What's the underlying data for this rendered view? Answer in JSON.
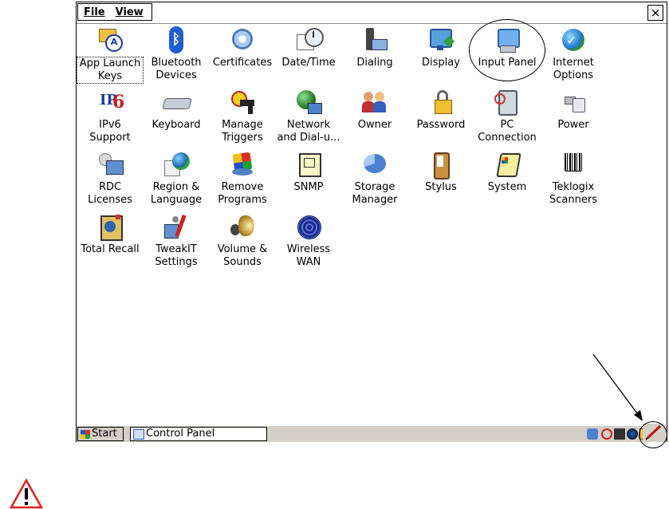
{
  "menu": {
    "file_label": "File",
    "view_label": "View",
    "close_label": "×"
  },
  "items": [
    {
      "label": "App Launch Keys",
      "icon": "app-launch-keys-icon",
      "selected": true
    },
    {
      "label": "Bluetooth Devices",
      "icon": "bluetooth-icon"
    },
    {
      "label": "Certificates",
      "icon": "certificates-icon"
    },
    {
      "label": "Date/Time",
      "icon": "date-time-icon"
    },
    {
      "label": "Dialing",
      "icon": "dialing-icon"
    },
    {
      "label": "Display",
      "icon": "display-icon"
    },
    {
      "label": "Input Panel",
      "icon": "input-panel-icon"
    },
    {
      "label": "Internet Options",
      "icon": "internet-options-icon"
    },
    {
      "label": "IPv6 Support",
      "icon": "ipv6-icon"
    },
    {
      "label": "Keyboard",
      "icon": "keyboard-icon"
    },
    {
      "label": "Manage Triggers",
      "icon": "manage-triggers-icon"
    },
    {
      "label": "Network and Dial-u...",
      "icon": "network-icon"
    },
    {
      "label": "Owner",
      "icon": "owner-icon"
    },
    {
      "label": "Password",
      "icon": "password-icon"
    },
    {
      "label": "PC Connection",
      "icon": "pc-connection-icon"
    },
    {
      "label": "Power",
      "icon": "power-icon"
    },
    {
      "label": "RDC Licenses",
      "icon": "rdc-licenses-icon"
    },
    {
      "label": "Region & Language",
      "icon": "region-language-icon"
    },
    {
      "label": "Remove Programs",
      "icon": "remove-programs-icon"
    },
    {
      "label": "SNMP",
      "icon": "snmp-icon"
    },
    {
      "label": "Storage Manager",
      "icon": "storage-manager-icon"
    },
    {
      "label": "Stylus",
      "icon": "stylus-icon"
    },
    {
      "label": "System",
      "icon": "system-icon"
    },
    {
      "label": "Teklogix Scanners",
      "icon": "barcode-scanner-icon"
    },
    {
      "label": "Total Recall",
      "icon": "total-recall-icon"
    },
    {
      "label": "TweakIT Settings",
      "icon": "tweakit-icon"
    },
    {
      "label": "Volume & Sounds",
      "icon": "volume-sounds-icon"
    },
    {
      "label": "Wireless WAN",
      "icon": "wireless-wan-icon"
    }
  ],
  "taskbar": {
    "start_label": "Start",
    "task_label": "Control Panel"
  },
  "colors": {
    "taskbar_bg": "#d4d0c8",
    "warning_red": "#e02020"
  }
}
